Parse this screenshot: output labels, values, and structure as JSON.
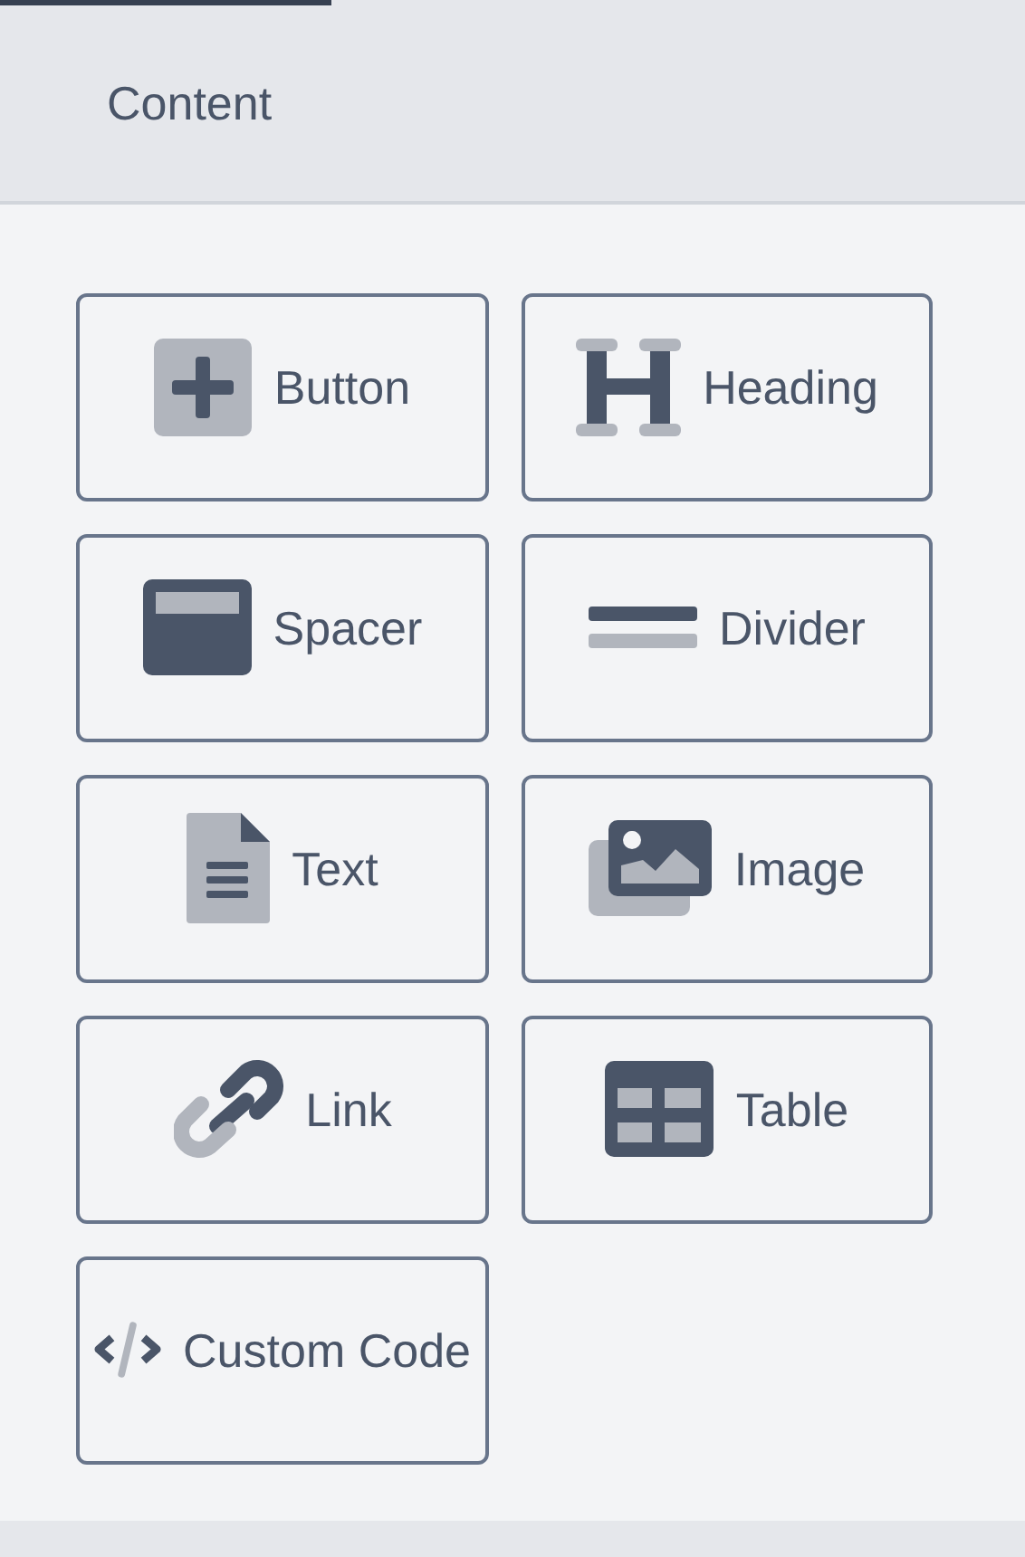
{
  "panel": {
    "title": "Content"
  },
  "blocks": [
    {
      "kind": "button",
      "label": "Button"
    },
    {
      "kind": "heading",
      "label": "Heading"
    },
    {
      "kind": "spacer",
      "label": "Spacer"
    },
    {
      "kind": "divider",
      "label": "Divider"
    },
    {
      "kind": "text",
      "label": "Text"
    },
    {
      "kind": "image",
      "label": "Image"
    },
    {
      "kind": "link",
      "label": "Link"
    },
    {
      "kind": "table",
      "label": "Table"
    },
    {
      "kind": "code",
      "label": "Custom Code"
    }
  ]
}
